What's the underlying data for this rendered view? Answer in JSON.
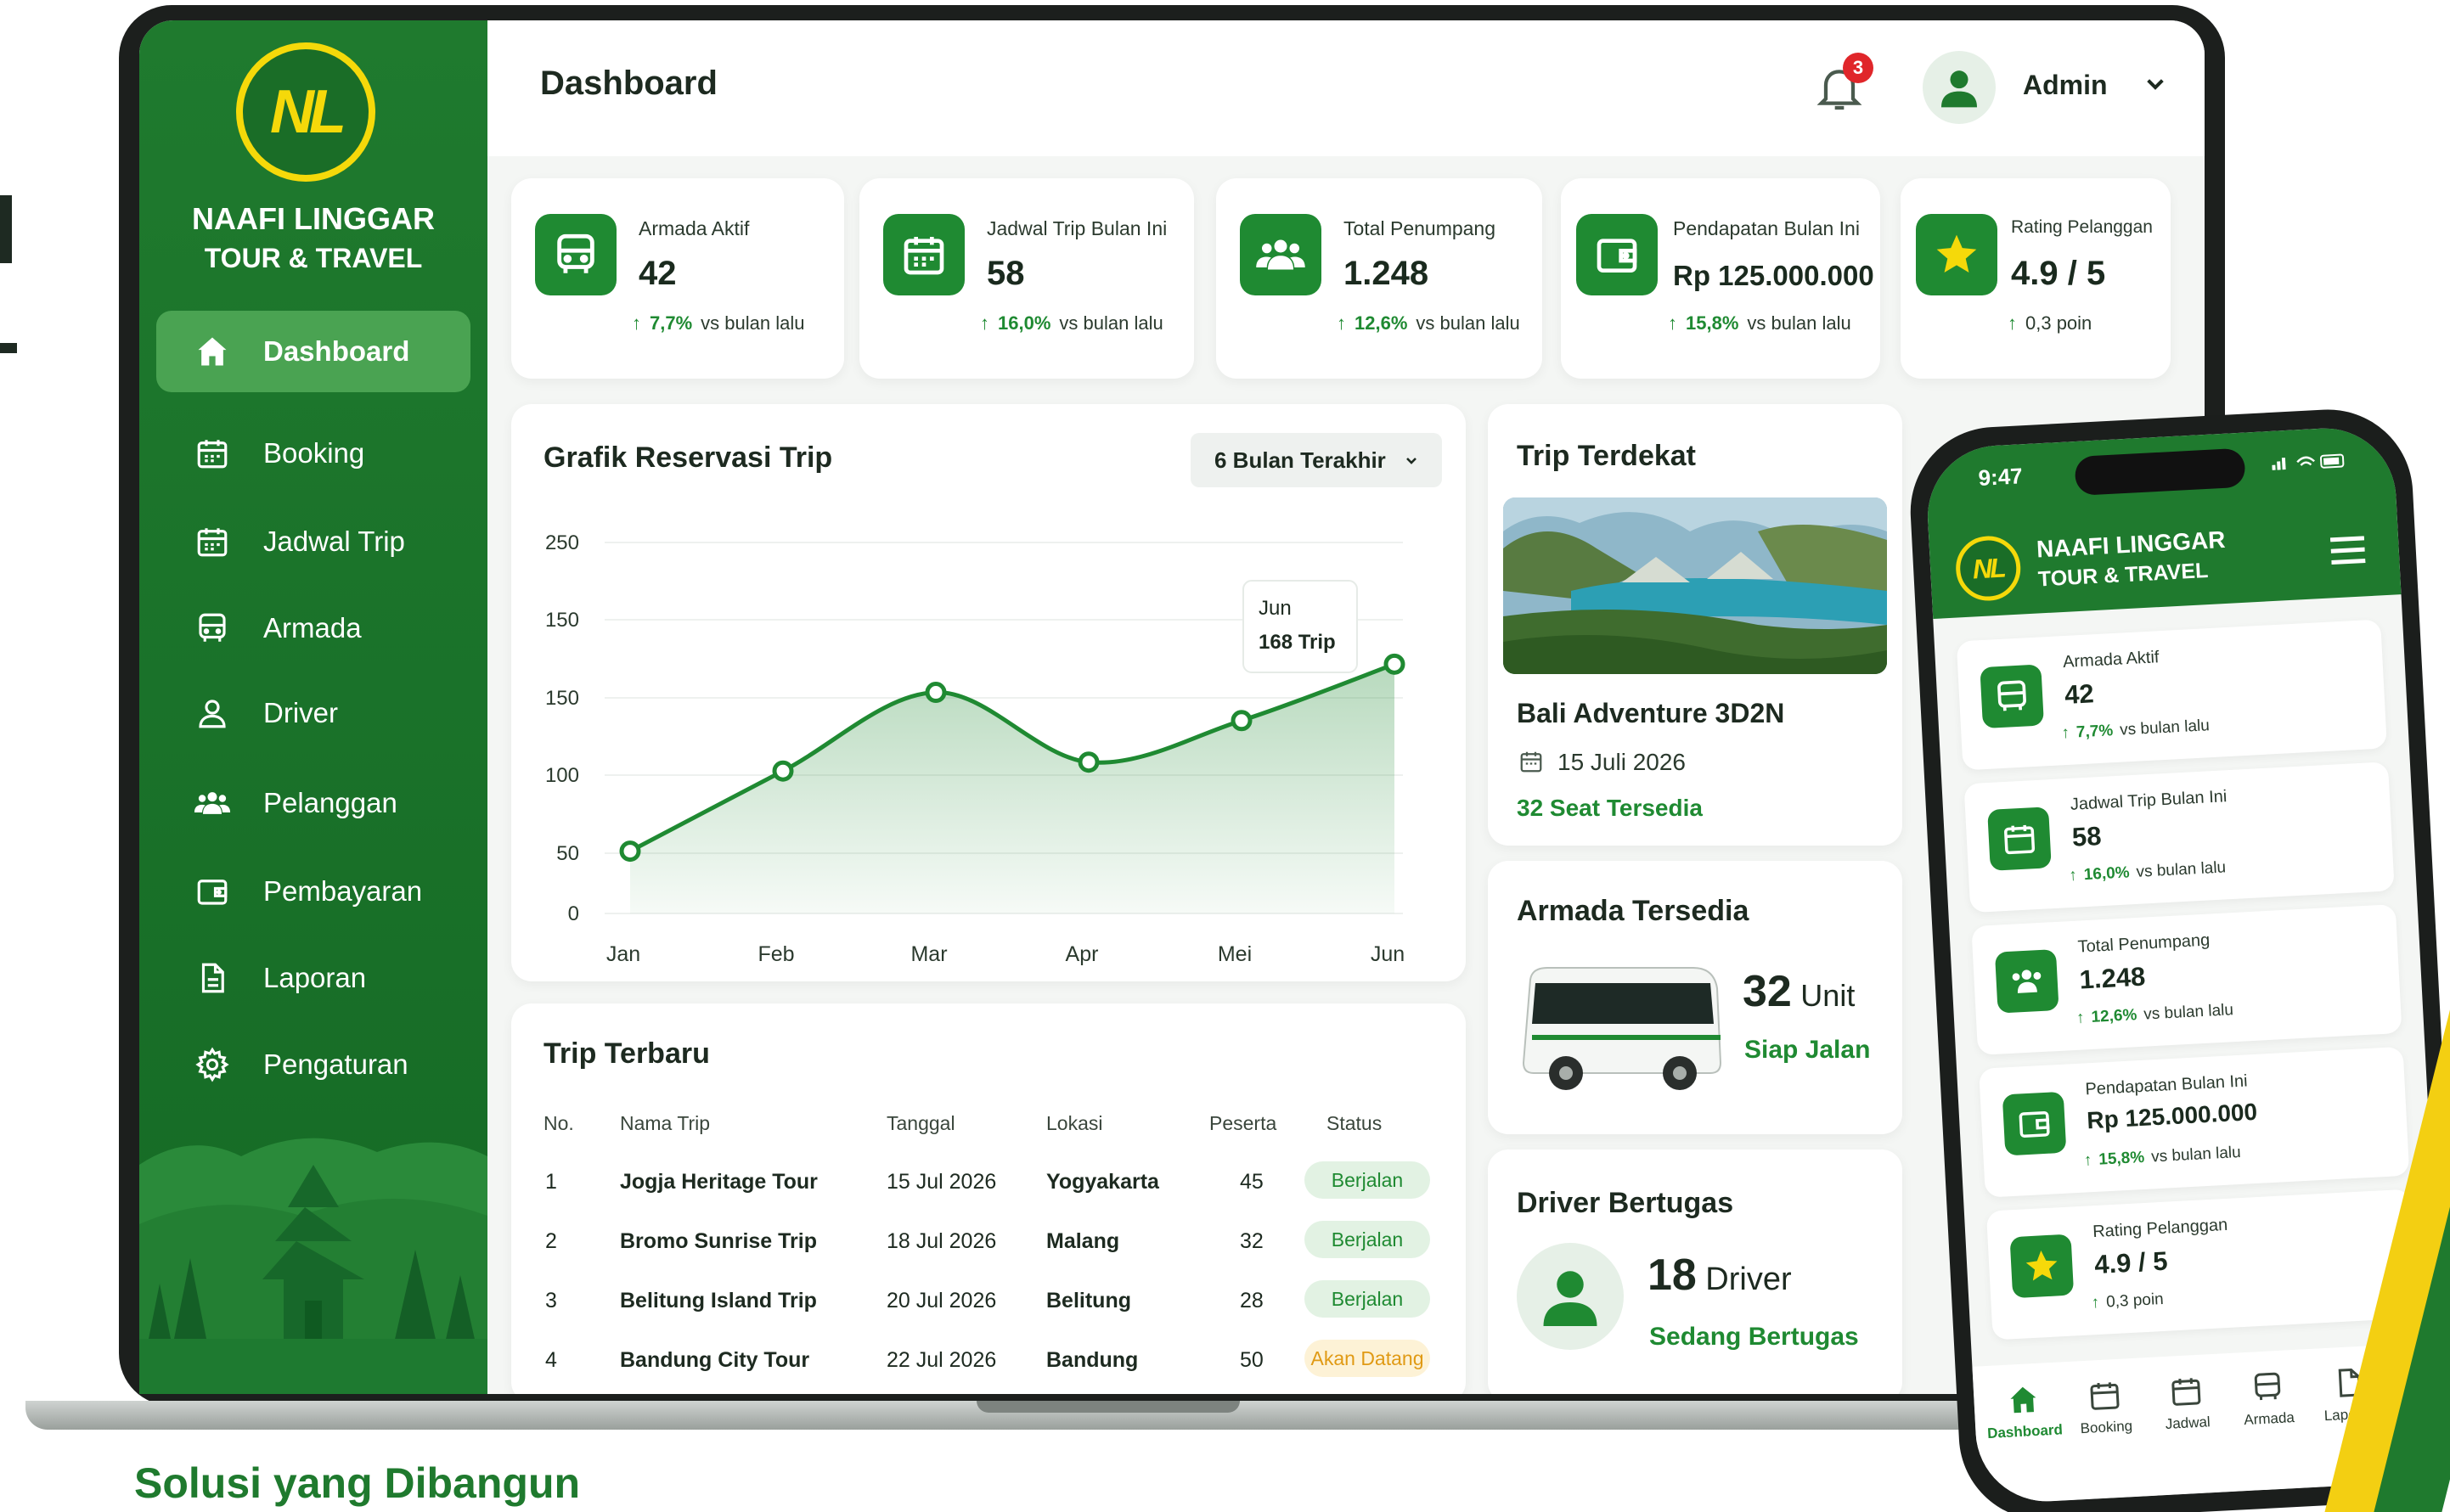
{
  "app": {
    "logo_text": "NL",
    "brand_name": "NAAFI LINGGAR",
    "brand_sub": "TOUR & TRAVEL",
    "page_title": "Dashboard",
    "notification_count": "3",
    "user_name": "Admin",
    "tagline": "Solusi yang Dibangun"
  },
  "sidebar": {
    "items": [
      {
        "label": "Dashboard",
        "icon": "home-icon",
        "active": true
      },
      {
        "label": "Booking",
        "icon": "calendar-icon"
      },
      {
        "label": "Jadwal Trip",
        "icon": "calendar-icon"
      },
      {
        "label": "Armada",
        "icon": "bus-icon"
      },
      {
        "label": "Driver",
        "icon": "user-icon"
      },
      {
        "label": "Pelanggan",
        "icon": "users-icon"
      },
      {
        "label": "Pembayaran",
        "icon": "wallet-icon"
      },
      {
        "label": "Laporan",
        "icon": "document-icon"
      },
      {
        "label": "Pengaturan",
        "icon": "gear-icon"
      }
    ]
  },
  "stats": [
    {
      "label": "Armada Aktif",
      "value": "42",
      "change": "7,7%",
      "note": "vs bulan lalu",
      "icon": "bus-icon"
    },
    {
      "label": "Jadwal Trip Bulan Ini",
      "value": "58",
      "change": "16,0%",
      "note": "vs bulan lalu",
      "icon": "calendar-icon"
    },
    {
      "label": "Total Penumpang",
      "value": "1.248",
      "change": "12,6%",
      "note": "vs bulan lalu",
      "icon": "users-icon"
    },
    {
      "label": "Pendapatan Bulan Ini",
      "value": "Rp 125.000.000",
      "change": "15,8%",
      "note": "vs bulan lalu",
      "icon": "wallet-icon"
    },
    {
      "label": "Rating Pelanggan",
      "value": "4.9 / 5",
      "change": "0,3 poin",
      "note": "",
      "icon": "star-icon"
    }
  ],
  "reservation_chart": {
    "title": "Grafik Reservasi Trip",
    "range_label": "6 Bulan Terakhir",
    "tooltip_month": "Jun",
    "tooltip_value": "168 Trip"
  },
  "chart_data": {
    "type": "area",
    "title": "Grafik Reservasi Trip",
    "categories": [
      "Jan",
      "Feb",
      "Mar",
      "Apr",
      "Mei",
      "Jun"
    ],
    "values": [
      42,
      96,
      149,
      102,
      130,
      168
    ],
    "ytick_labels": [
      "250",
      "150",
      "150",
      "100",
      "50",
      "0"
    ],
    "grid": true,
    "accent": "#1f8a32"
  },
  "trip_terbaru": {
    "title": "Trip Terbaru",
    "headers": [
      "No.",
      "Nama Trip",
      "Tanggal",
      "Lokasi",
      "Peserta",
      "Status"
    ],
    "rows": [
      {
        "no": "1",
        "name": "Jogja Heritage Tour",
        "date": "15 Jul 2026",
        "loc": "Yogyakarta",
        "pax": "45",
        "status": "Berjalan",
        "kind": "go"
      },
      {
        "no": "2",
        "name": "Bromo Sunrise Trip",
        "date": "18 Jul 2026",
        "loc": "Malang",
        "pax": "32",
        "status": "Berjalan",
        "kind": "go"
      },
      {
        "no": "3",
        "name": "Belitung Island Trip",
        "date": "20 Jul 2026",
        "loc": "Belitung",
        "pax": "28",
        "status": "Berjalan",
        "kind": "go"
      },
      {
        "no": "4",
        "name": "Bandung City Tour",
        "date": "22 Jul 2026",
        "loc": "Bandung",
        "pax": "50",
        "status": "Akan Datang",
        "kind": "soon"
      }
    ]
  },
  "trip_terdekat": {
    "title": "Trip Terdekat",
    "name": "Bali Adventure 3D2N",
    "date": "15 Juli 2026",
    "seats": "32 Seat Tersedia"
  },
  "armada": {
    "title": "Armada Tersedia",
    "count": "32",
    "unit": "Unit",
    "status": "Siap Jalan"
  },
  "driver": {
    "title": "Driver Bertugas",
    "count": "18",
    "unit": "Driver",
    "status": "Sedang Bertugas"
  },
  "phone": {
    "time": "9:47",
    "brand_name": "NAAFI LINGGAR",
    "brand_sub": "TOUR & TRAVEL",
    "nav": [
      {
        "label": "Dashboard",
        "icon": "home-icon",
        "active": true
      },
      {
        "label": "Booking",
        "icon": "calendar-icon"
      },
      {
        "label": "Jadwal",
        "icon": "calendar-icon"
      },
      {
        "label": "Armada",
        "icon": "bus-icon"
      },
      {
        "label": "Laporan",
        "icon": "document-icon"
      }
    ]
  },
  "colors": {
    "primary": "#1f7a2e",
    "accent": "#1f8a32",
    "logo_yellow": "#f5d90a",
    "badge_red": "#e0262a",
    "warning": "#e09a14"
  }
}
